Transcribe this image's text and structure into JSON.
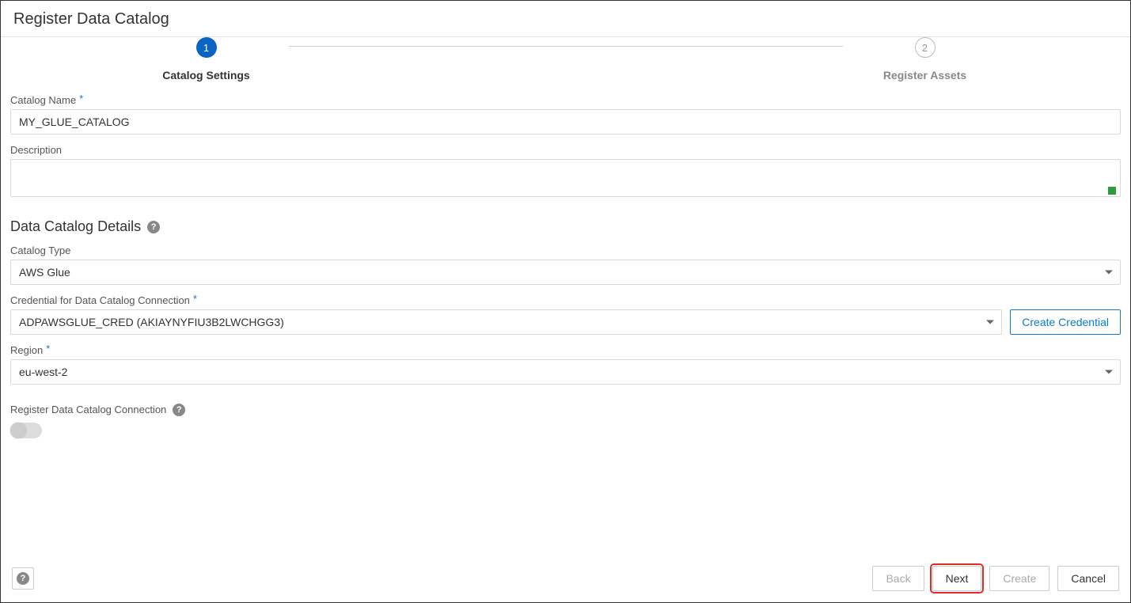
{
  "header": {
    "title": "Register Data Catalog"
  },
  "stepper": {
    "step1": {
      "num": "1",
      "label": "Catalog Settings"
    },
    "step2": {
      "num": "2",
      "label": "Register Assets"
    }
  },
  "fields": {
    "catalog_name": {
      "label": "Catalog Name",
      "value": "MY_GLUE_CATALOG"
    },
    "description": {
      "label": "Description",
      "value": ""
    },
    "catalog_type": {
      "label": "Catalog Type",
      "value": "AWS Glue"
    },
    "credential": {
      "label": "Credential for Data Catalog Connection",
      "value": "ADPAWSGLUE_CRED (AKIAYNYFIU3B2LWCHGG3)"
    },
    "region": {
      "label": "Region",
      "value": "eu-west-2"
    },
    "register_conn": {
      "label": "Register Data Catalog Connection"
    }
  },
  "section": {
    "details_title": "Data Catalog Details"
  },
  "buttons": {
    "create_credential": "Create Credential",
    "back": "Back",
    "next": "Next",
    "create": "Create",
    "cancel": "Cancel"
  }
}
